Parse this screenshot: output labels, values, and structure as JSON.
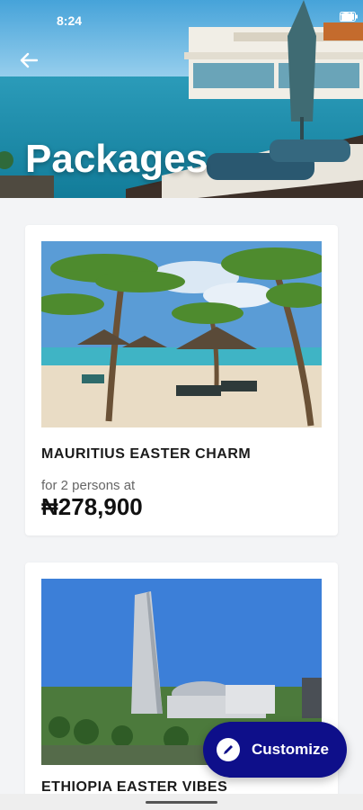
{
  "status_bar": {
    "time": "8:24",
    "battery": "93"
  },
  "header": {
    "title": "Packages"
  },
  "packages": [
    {
      "name": "MAURITIUS EASTER CHARM",
      "subtitle": "for 2 persons at",
      "price": "₦278,900"
    },
    {
      "name": "ETHIOPIA EASTER VIBES"
    }
  ],
  "fab": {
    "label": "Customize"
  },
  "colors": {
    "accent": "#0e0f8a",
    "background": "#f3f4f6"
  }
}
